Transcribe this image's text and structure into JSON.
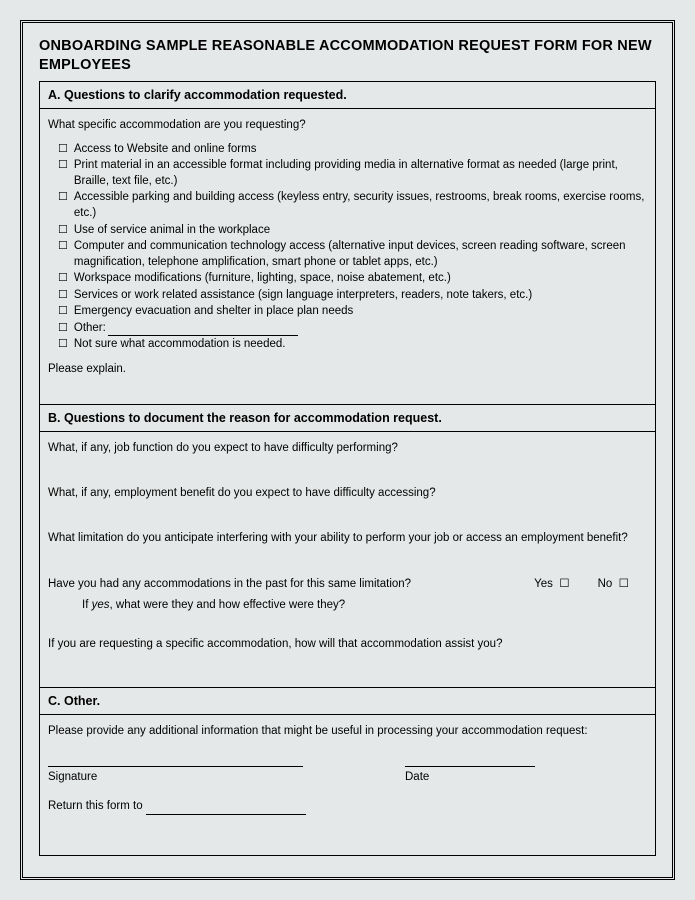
{
  "title": "ONBOARDING SAMPLE REASONABLE ACCOMMODATION REQUEST FORM FOR NEW EMPLOYEES",
  "sectionA": {
    "header": "A. Questions to clarify accommodation requested.",
    "question": "What specific accommodation are you requesting?",
    "items": [
      "Access to Website and online forms",
      "Print material in an accessible format including providing media in alternative format as needed (large print, Braille, text file, etc.)",
      "Accessible parking and building access (keyless entry, security issues, restrooms, break rooms, exercise rooms, etc.)",
      "Use of service animal in the workplace",
      "Computer and communication technology access (alternative input devices, screen reading software, screen magnification, telephone amplification, smart phone or tablet apps, etc.)",
      "Workspace modifications (furniture, lighting, space, noise abatement, etc.)",
      "Services or work related assistance (sign language interpreters, readers, note takers, etc.)",
      "Emergency evacuation and shelter in place plan needs"
    ],
    "otherLabel": "Other:",
    "notSure": "Not sure what accommodation is needed.",
    "explain": "Please explain."
  },
  "sectionB": {
    "header": "B. Questions to document the reason for accommodation request.",
    "q1": "What, if any, job function do you expect to have difficulty performing?",
    "q2": "What, if any, employment benefit do you expect to have difficulty accessing?",
    "q3": "What limitation do you anticipate interfering with your ability to perform your job or access an employment benefit?",
    "q4": "Have you had any accommodations in the past for this same limitation?",
    "yes": "Yes",
    "no": "No",
    "q4followPrefix": "If ",
    "q4followItalic": "yes",
    "q4followSuffix": ", what were they and how effective were they?",
    "q5": "If you are requesting a specific accommodation, how will that accommodation assist you?"
  },
  "sectionC": {
    "header": "C. Other.",
    "intro": "Please provide any additional information that might be useful in processing your accommodation request:",
    "signature": "Signature",
    "date": "Date",
    "return": "Return this form to"
  }
}
